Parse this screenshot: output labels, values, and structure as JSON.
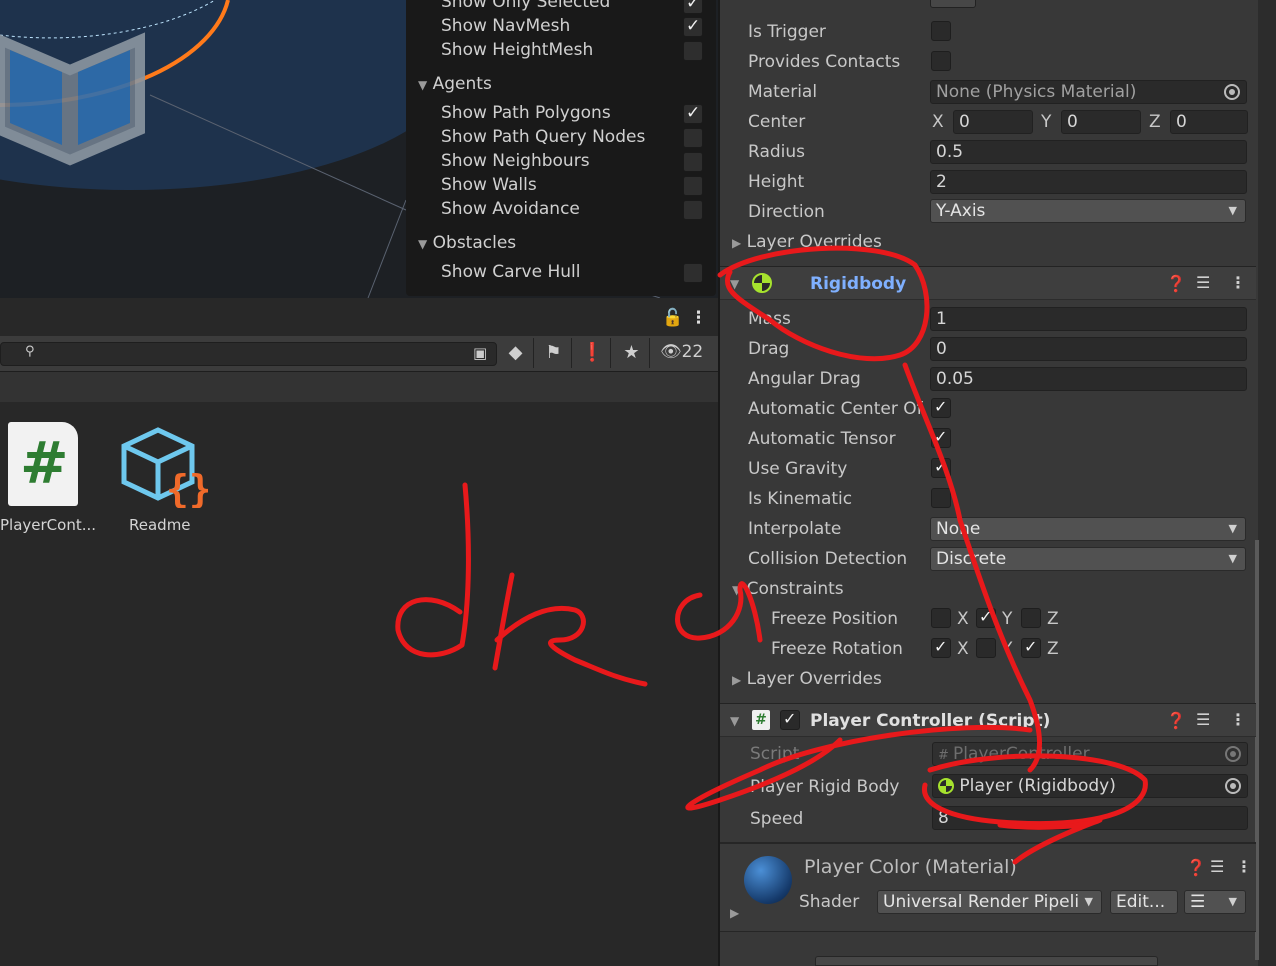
{
  "scene": {
    "navmesh_panel": {
      "rows": [
        {
          "label": "Show Only Selected",
          "checked": true
        },
        {
          "label": "Show NavMesh",
          "checked": true
        },
        {
          "label": "Show HeightMesh",
          "checked": false
        }
      ],
      "agents_section": "Agents",
      "agent_rows": [
        {
          "label": "Show Path Polygons",
          "checked": true
        },
        {
          "label": "Show Path Query Nodes",
          "checked": false
        },
        {
          "label": "Show Neighbours",
          "checked": false
        },
        {
          "label": "Show Walls",
          "checked": false
        },
        {
          "label": "Show Avoidance",
          "checked": false
        }
      ],
      "obstacles_section": "Obstacles",
      "obstacle_rows": [
        {
          "label": "Show Carve Hull",
          "checked": false
        }
      ]
    }
  },
  "project": {
    "search_placeholder": "",
    "hidden_count": "22",
    "assets": [
      {
        "name": "PlayerCont...",
        "icon": "csharp-script-icon"
      },
      {
        "name": "Readme",
        "icon": "readme-asset-icon"
      }
    ]
  },
  "inspector": {
    "collider": {
      "is_trigger": "Is Trigger",
      "provides_contacts": "Provides Contacts",
      "material_label": "Material",
      "material_value": "None (Physics Material)",
      "center_label": "Center",
      "center": {
        "x_label": "X",
        "x": "0",
        "y_label": "Y",
        "y": "0",
        "z_label": "Z",
        "z": "0"
      },
      "radius_label": "Radius",
      "radius": "0.5",
      "height_label": "Height",
      "height": "2",
      "direction_label": "Direction",
      "direction": "Y-Axis",
      "layer_overrides": "Layer Overrides"
    },
    "rigidbody": {
      "title": "Rigidbody",
      "mass_label": "Mass",
      "mass": "1",
      "drag_label": "Drag",
      "drag": "0",
      "angular_drag_label": "Angular Drag",
      "angular_drag": "0.05",
      "auto_center_label": "Automatic Center Of",
      "auto_center": true,
      "auto_tensor_label": "Automatic Tensor",
      "auto_tensor": true,
      "use_gravity_label": "Use Gravity",
      "use_gravity": true,
      "is_kinematic_label": "Is Kinematic",
      "is_kinematic": false,
      "interpolate_label": "Interpolate",
      "interpolate": "None",
      "collision_label": "Collision Detection",
      "collision": "Discrete",
      "constraints_label": "Constraints",
      "freeze_position_label": "Freeze Position",
      "freeze_position": {
        "x": false,
        "y": true,
        "z": false
      },
      "freeze_rotation_label": "Freeze Rotation",
      "freeze_rotation": {
        "x": true,
        "y": false,
        "z": true
      },
      "axis_x": "X",
      "axis_y": "Y",
      "axis_z": "Z",
      "layer_overrides": "Layer Overrides"
    },
    "player_controller": {
      "title": "Player Controller (Script)",
      "script_label": "Script",
      "script_value": "PlayerController",
      "rigid_body_label": "Player Rigid Body",
      "rigid_body_value": "Player (Rigidbody)",
      "speed_label": "Speed",
      "speed": "8"
    },
    "material": {
      "title": "Player Color (Material)",
      "shader_label": "Shader",
      "shader_value": "Universal Render Pipeli",
      "edit_button": "Edit..."
    }
  },
  "annotation": {
    "handwriting": "dkq",
    "stroke_color": "#e8191b"
  },
  "colors": {
    "inspector_bg": "#383838",
    "field_bg": "#2a2a2a",
    "accent_title": "#7fb0ff",
    "rigidbody_icon": "#a6e22e"
  }
}
